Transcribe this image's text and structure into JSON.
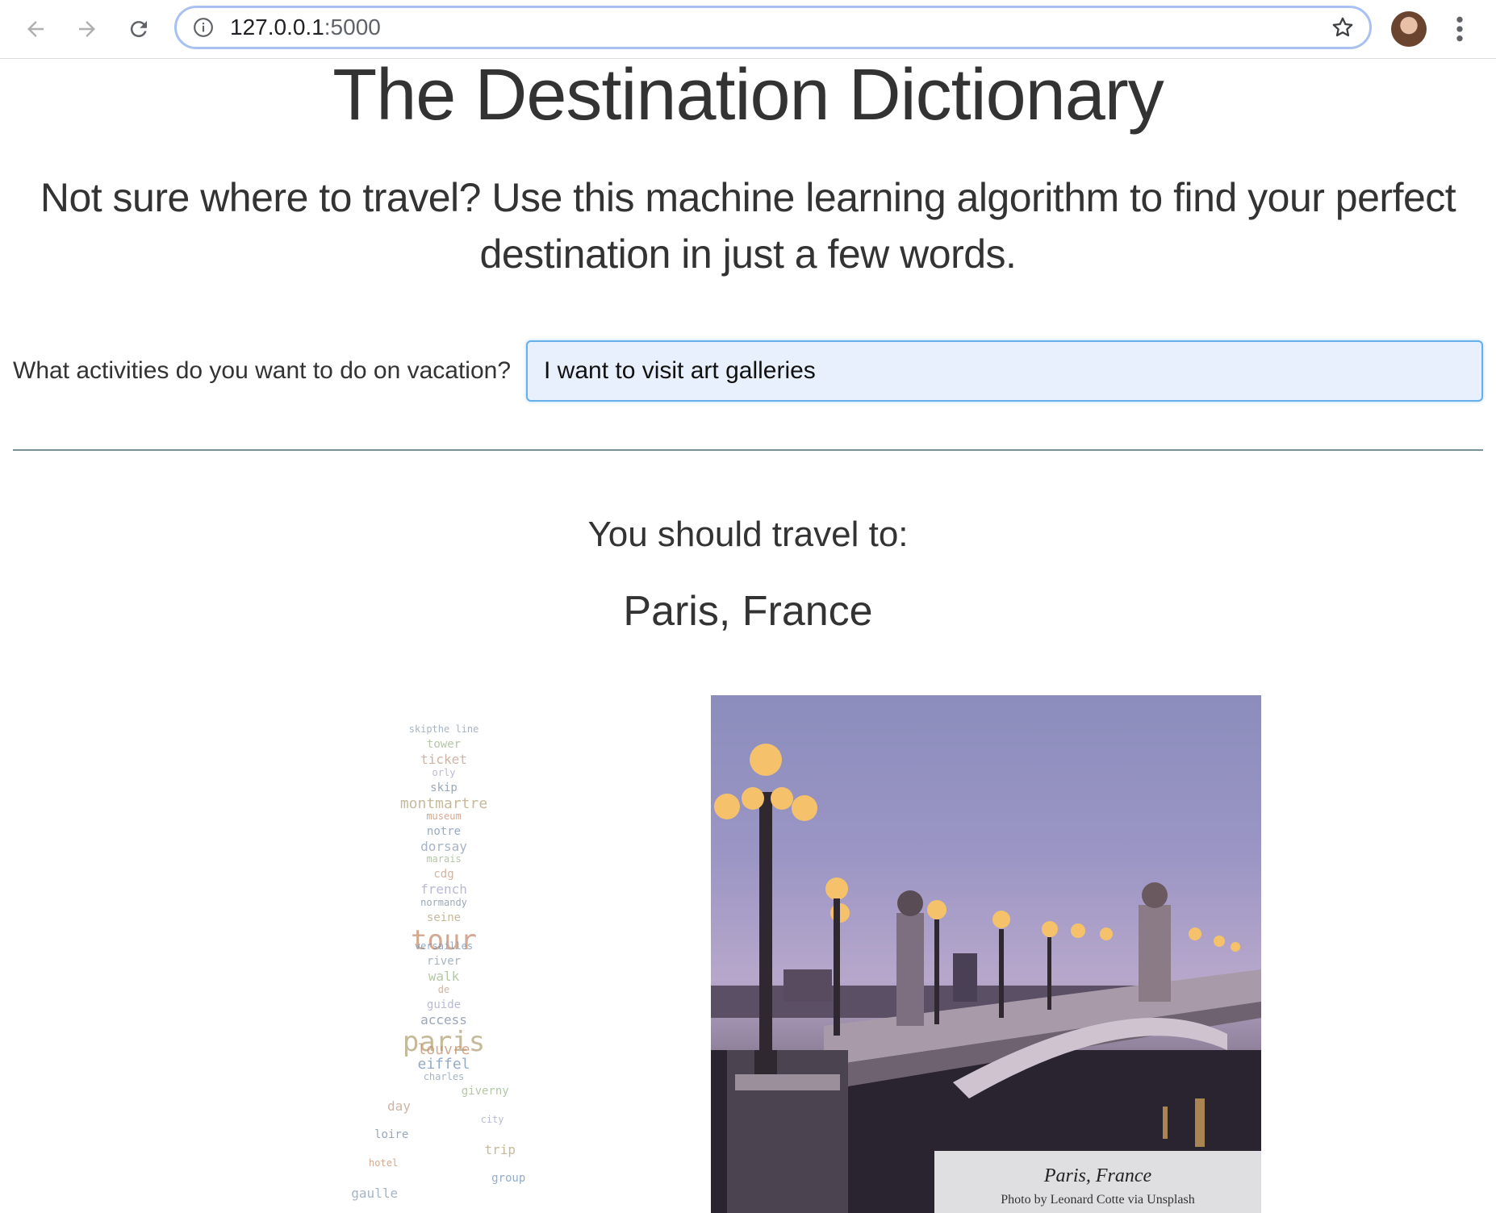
{
  "browser": {
    "url_host": "127.0.0.1",
    "url_port": ":5000"
  },
  "page": {
    "title": "The Destination Dictionary",
    "subtitle": "Not sure where to travel? Use this machine learning algorithm to find your perfect destination in just a few words."
  },
  "form": {
    "question": "What activities do you want to do on vacation?",
    "input_value": "I want to visit art galleries"
  },
  "result": {
    "heading": "You should travel to:",
    "destination": "Paris, France"
  },
  "photo": {
    "caption_title": "Paris, France",
    "caption_credit": "Photo by Leonard Cotte via Unsplash"
  },
  "wordcloud": {
    "words": [
      "skipthe line",
      "tower",
      "ticket",
      "orly",
      "skip",
      "montmartre",
      "museum",
      "notre",
      "dorsay",
      "marais",
      "cdg",
      "french",
      "normandy",
      "seine",
      "tour",
      "versailles",
      "river",
      "walk",
      "de",
      "guide",
      "access",
      "paris",
      "louvre",
      "eiffel",
      "charles",
      "giverny",
      "day",
      "city",
      "loire",
      "trip",
      "hotel",
      "group",
      "gaulle"
    ]
  },
  "colors": {
    "accent_input_border": "#66afe9",
    "input_background": "#e8f0fe",
    "divider": "#7a909a"
  }
}
